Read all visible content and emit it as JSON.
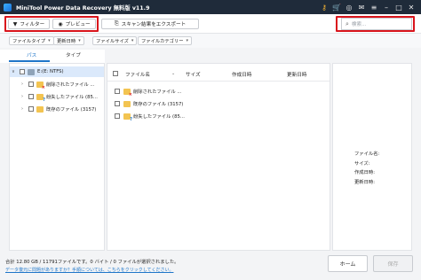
{
  "window": {
    "title": "MiniTool Power Data Recovery 無料版 v11.9"
  },
  "titlebar_icons": [
    "key-icon",
    "cart-icon",
    "headset-icon",
    "mail-icon",
    "menu-icon",
    "minimize-icon",
    "maximize-icon",
    "close-icon"
  ],
  "toolbar": {
    "filter_label": "フィルター",
    "preview_label": "プレビュー",
    "export_label": "スキャン結果をエクスポート",
    "search_placeholder": "検索..."
  },
  "filters": {
    "file_type": "ファイルタイプ",
    "modified_date": "更新日時",
    "file_size": "ファイルサイズ",
    "file_category": "ファイルカテゴリー"
  },
  "tabs": {
    "path": "パス",
    "type": "タイプ"
  },
  "tree": {
    "root": "E:(E: NTFS)",
    "children": [
      "削除されたファイル ...",
      "紛失したファイル (85...",
      "既存のファイル (3157)"
    ]
  },
  "list": {
    "columns": {
      "name": "ファイル名",
      "size": "サイズ",
      "created": "作成日時",
      "modified": "更新日時"
    },
    "rows": [
      "削除されたファイル ...",
      "既存のファイル (3157)",
      "紛失したファイル (85..."
    ]
  },
  "preview": {
    "filename_label": "ファイル名:",
    "size_label": "サイズ:",
    "created_label": "作成日時:",
    "modified_label": "更新日時:"
  },
  "footer": {
    "summary": "合計 12.80 GB / 11791ファイルです。0 バイト / 0 ファイルが選択されました。",
    "help_link": "データ復元に問題がありますか？手順については、こちらをクリックしてください。",
    "home_label": "ホーム",
    "save_label": "保存"
  },
  "colors": {
    "titlebar": "#1f2b3a",
    "accent": "#1f76c9",
    "highlight": "#d9141c",
    "folder": "#f3c451"
  }
}
